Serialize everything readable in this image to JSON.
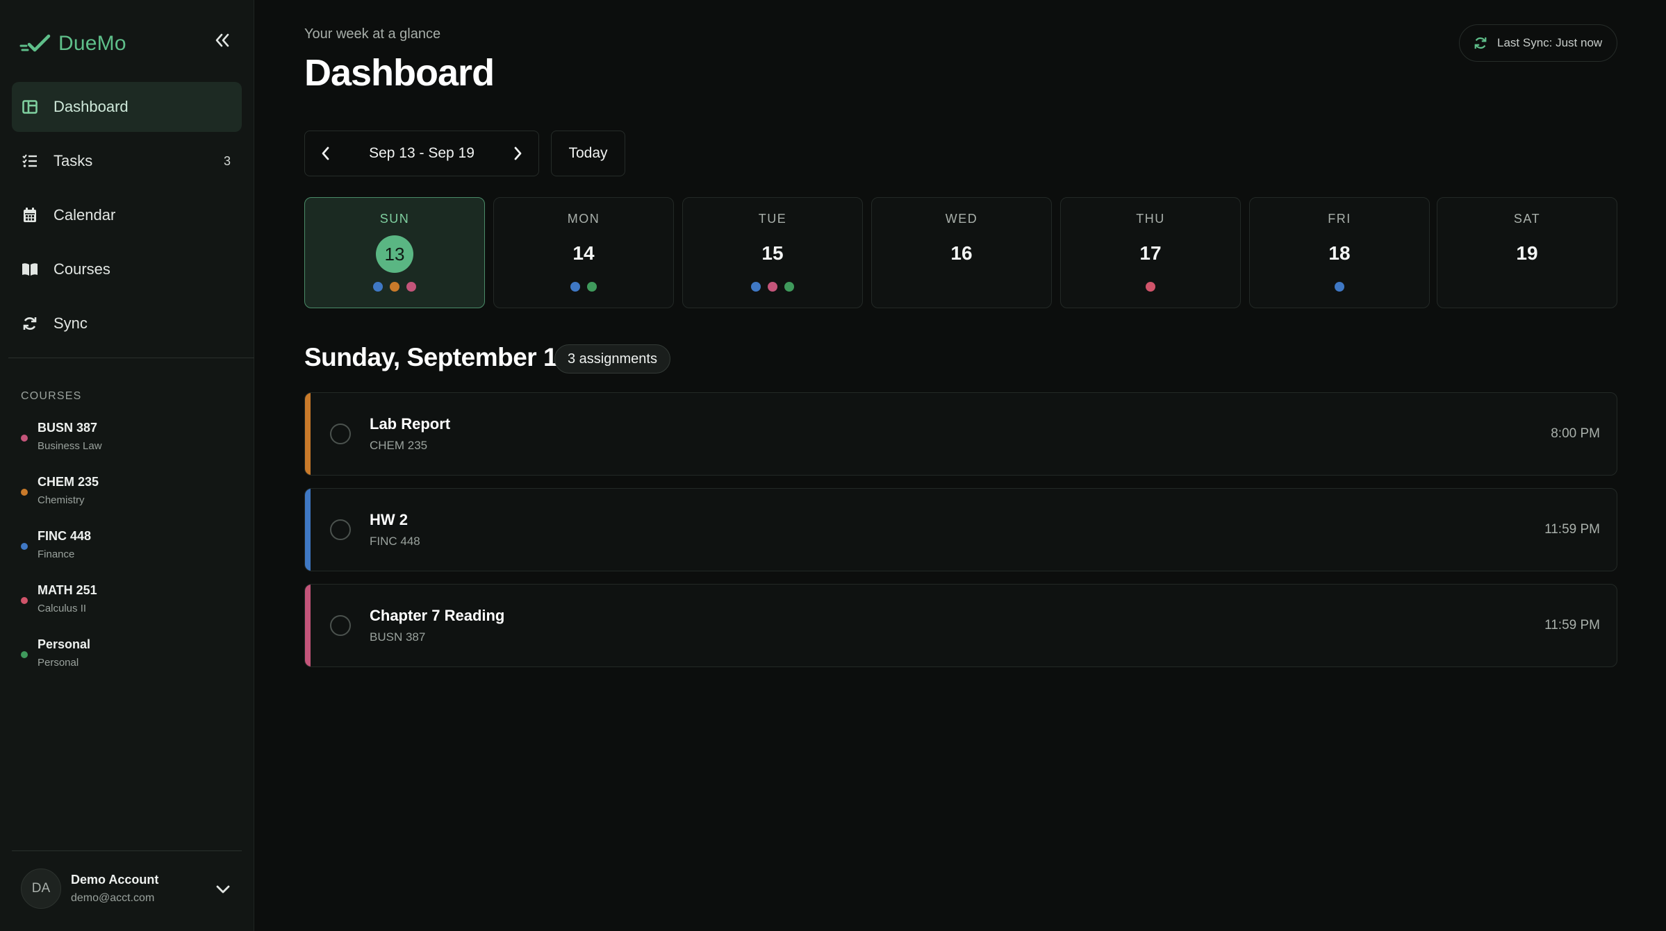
{
  "app": {
    "name": "DueMo"
  },
  "sidebar": {
    "nav": [
      {
        "label": "Dashboard",
        "icon": "dashboard-icon",
        "active": true
      },
      {
        "label": "Tasks",
        "icon": "tasks-icon",
        "count": "3"
      },
      {
        "label": "Calendar",
        "icon": "calendar-icon"
      },
      {
        "label": "Courses",
        "icon": "book-icon"
      },
      {
        "label": "Sync",
        "icon": "sync-icon"
      }
    ],
    "courses_heading": "COURSES",
    "courses": [
      {
        "code": "BUSN 387",
        "name": "Business Law",
        "color": "#c4557a"
      },
      {
        "code": "CHEM 235",
        "name": "Chemistry",
        "color": "#c97a2a"
      },
      {
        "code": "FINC 448",
        "name": "Finance",
        "color": "#3f78c4"
      },
      {
        "code": "MATH 251",
        "name": "Calculus II",
        "color": "#d0546a"
      },
      {
        "code": "Personal",
        "name": "Personal",
        "color": "#3f9a5c"
      }
    ],
    "account": {
      "initials": "DA",
      "name": "Demo Account",
      "email": "demo@acct.com"
    }
  },
  "header": {
    "subtitle": "Your week at a glance",
    "title": "Dashboard",
    "sync_status": "Last Sync: Just now"
  },
  "week": {
    "range": "Sep 13 - Sep 19",
    "today_label": "Today",
    "days": [
      {
        "name": "SUN",
        "date": "13",
        "selected": true,
        "dots": [
          "#3f78c4",
          "#c97a2a",
          "#c4557a"
        ]
      },
      {
        "name": "MON",
        "date": "14",
        "dots": [
          "#3f78c4",
          "#3f9a5c"
        ]
      },
      {
        "name": "TUE",
        "date": "15",
        "dots": [
          "#3f78c4",
          "#c4557a",
          "#3f9a5c"
        ]
      },
      {
        "name": "WED",
        "date": "16",
        "dots": []
      },
      {
        "name": "THU",
        "date": "17",
        "dots": [
          "#d0546a"
        ]
      },
      {
        "name": "FRI",
        "date": "18",
        "dots": [
          "#3f78c4"
        ]
      },
      {
        "name": "SAT",
        "date": "19",
        "dots": []
      }
    ]
  },
  "selected_day": {
    "heading": "Sunday, September 13",
    "count_label": "3 assignments",
    "tasks": [
      {
        "title": "Lab Report",
        "course": "CHEM 235",
        "time": "8:00 PM",
        "color": "#c97a2a"
      },
      {
        "title": "HW 2",
        "course": "FINC 448",
        "time": "11:59 PM",
        "color": "#3f78c4"
      },
      {
        "title": "Chapter 7 Reading",
        "course": "BUSN 387",
        "time": "11:59 PM",
        "color": "#c4557a"
      }
    ]
  },
  "colors": {
    "accent": "#5ab683",
    "background": "#0c0e0d",
    "sidebar": "#121614"
  }
}
